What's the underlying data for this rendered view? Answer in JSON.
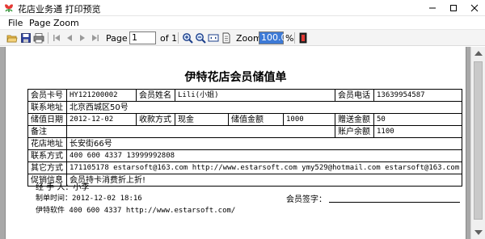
{
  "window": {
    "title": "花店业务通 打印预览"
  },
  "menu": [
    "File",
    "Page",
    "Zoom"
  ],
  "toolbar": {
    "page_label": "Page",
    "page_value": "1",
    "of_label": "of 1",
    "zoom_label": "Zoom",
    "zoom_value": "100.0",
    "percent": "%"
  },
  "document": {
    "title": "伊特花店会员储值单",
    "rows": {
      "card_label": "会员卡号",
      "card_value": "HY121200002",
      "name_label": "会员姓名",
      "name_value": "Lili(小姐)",
      "phone_label": "会员电话",
      "phone_value": "13639954587",
      "address_label": "联系地址",
      "address_value": "北京西城区50号",
      "date_label": "储值日期",
      "date_value": "2012-12-02",
      "pay_method_label": "收款方式",
      "pay_method_value": "现金",
      "amount_label": "储值金额",
      "amount_value": "1000",
      "bonus_label": "赠送金额",
      "bonus_value": "50",
      "remark_label": "备注",
      "balance_label": "账户余额",
      "balance_value": "1100",
      "shop_address_label": "花店地址",
      "shop_address_value": "长安街66号",
      "contact_label": "联系方式",
      "contact_value": "400 600 4337  13999992808",
      "other_label": "其它方式",
      "other_value": "171105178 estarsoft@163.com http://www.estarsoft.com ymy529@hotmail.com estarsoft@163.com",
      "promo_label": "促销信息",
      "promo_value": "会员持卡消费折上折!"
    },
    "handler": "经 手 人：小李",
    "made_time": "制单时间：2012-12-02 18:16",
    "member_sign": "会员签字：",
    "company": "伊特软件 400 600 4337 http://www.estarsoft.com/"
  }
}
